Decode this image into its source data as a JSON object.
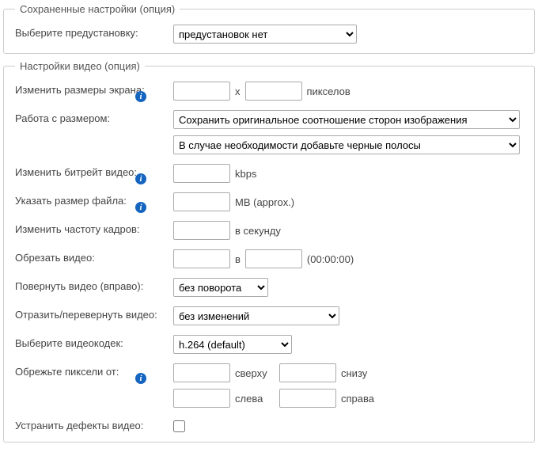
{
  "saved": {
    "legend": "Сохраненные настройки (опция)",
    "preset_label": "Выберите предустановку:",
    "preset_value": "предустановок нет"
  },
  "video": {
    "legend": "Настройки видео (опция)",
    "screen_size_label": "Изменить размеры экрана:",
    "screen_size_x": "x",
    "screen_size_unit": "пикселов",
    "size_handling_label": "Работа с размером:",
    "size_handling_aspect": "Сохранить оригинальное соотношение сторон изображения",
    "size_handling_bars": "В случае необходимости добавьте черные полосы",
    "bitrate_label": "Изменить битрейт видео:",
    "bitrate_unit": "kbps",
    "filesize_label": "Указать размер файла:",
    "filesize_unit": "MB (approx.)",
    "fps_label": "Изменить частоту кадров:",
    "fps_unit": "в секунду",
    "trim_label": "Обрезать видео:",
    "trim_sep": "в",
    "trim_hint": "(00:00:00)",
    "rotate_label": "Повернуть видео (вправо):",
    "rotate_value": "без поворота",
    "flip_label": "Отразить/перевернуть видео:",
    "flip_value": "без изменений",
    "codec_label": "Выберите видеокодек:",
    "codec_value": "h.264 (default)",
    "crop_label": "Обрежьте пиксели от:",
    "crop_top": "сверху",
    "crop_bottom": "снизу",
    "crop_left": "слева",
    "crop_right": "справа",
    "deinterlace_label": "Устранить дефекты видео:"
  }
}
